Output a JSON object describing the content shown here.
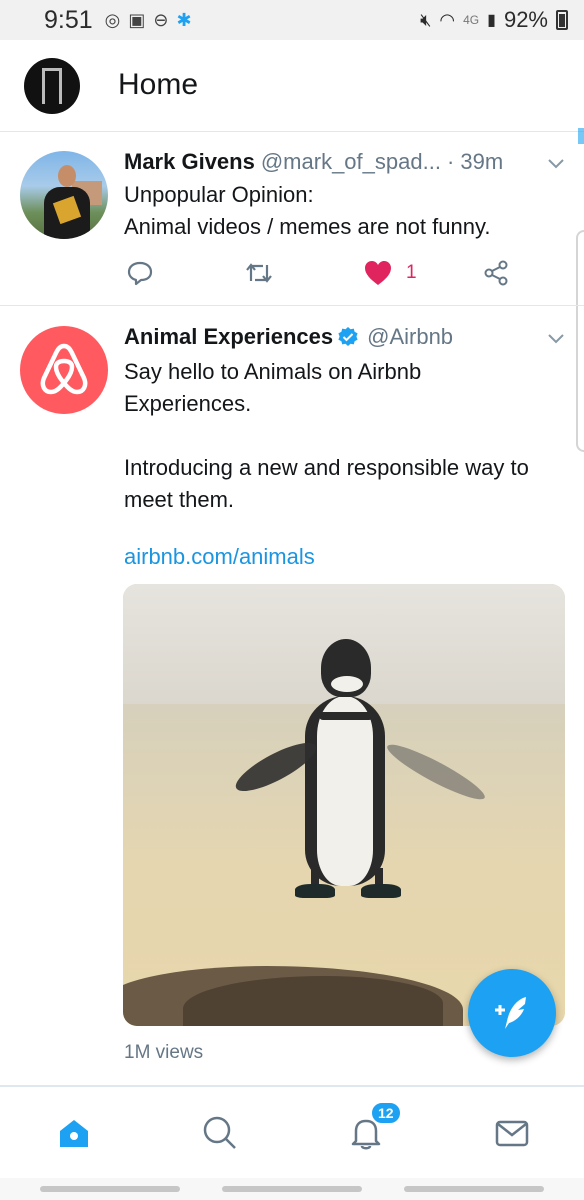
{
  "status_bar": {
    "time": "9:51",
    "network": "4G",
    "battery": "92%"
  },
  "header": {
    "title": "Home"
  },
  "tweets": [
    {
      "display_name": "Mark Givens",
      "handle": "@mark_of_spad...",
      "time": "· 39m",
      "text": "Unpopular Opinion:\nAnimal videos / memes are not funny.",
      "like_count": "1"
    },
    {
      "display_name": "Animal Experiences",
      "handle": "@Airbnb",
      "verified": true,
      "text": "Say hello to Animals on Airbnb Experiences.\n\nIntroducing a new and responsible way to meet them.",
      "link": "airbnb.com/animals",
      "views": "1M views"
    }
  ],
  "bottom_nav": {
    "notification_badge": "12"
  },
  "colors": {
    "accent": "#1da1f2",
    "like": "#e0245e",
    "brand_airbnb": "#ff5a5f"
  }
}
